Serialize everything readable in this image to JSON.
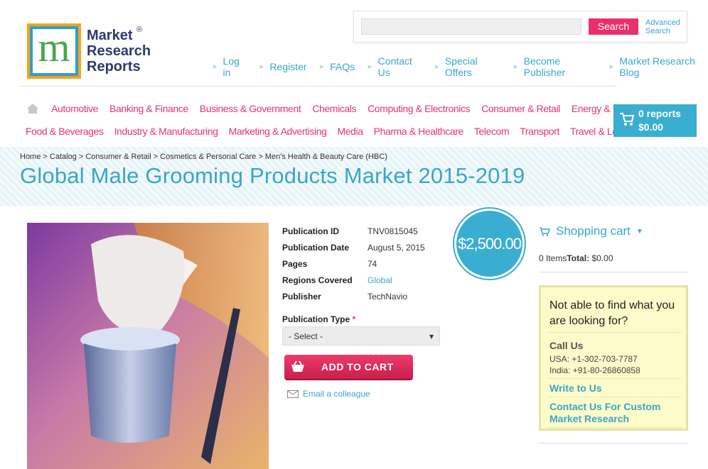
{
  "logo": {
    "line1": "Market",
    "line2": "Research",
    "line3": "Reports",
    "reg": "®",
    "mark": "m"
  },
  "search": {
    "placeholder": "",
    "button": "Search",
    "advanced": "Advanced Search"
  },
  "top_links": [
    "Log in",
    "Register",
    "FAQs",
    "Contact Us",
    "Special Offers",
    "Become Publisher",
    "Market Research Blog"
  ],
  "nav_row1": [
    "Automotive",
    "Banking & Finance",
    "Business & Government",
    "Chemicals",
    "Computing & Electronics",
    "Consumer & Retail",
    "Energy & Utilities"
  ],
  "nav_row2": [
    "Food & Beverages",
    "Industry & Manufacturing",
    "Marketing & Advertising",
    "Media",
    "Pharma & Healthcare",
    "Telecom",
    "Transport",
    "Travel & Leisure"
  ],
  "cart_mini": {
    "reports": "0 reports",
    "amount": "$0.00"
  },
  "breadcrumb": "Home > Catalog > Consumer & Retail > Cosmetics & Personal Care > Men's Health & Beauty Care (HBC)",
  "title": "Global Male Grooming Products Market 2015-2019",
  "details": [
    {
      "k": "Publication ID",
      "v": "TNV0815045"
    },
    {
      "k": "Publication Date",
      "v": "August 5, 2015"
    },
    {
      "k": "Pages",
      "v": "74"
    },
    {
      "k": "Regions Covered",
      "v": "Global"
    },
    {
      "k": "Publisher",
      "v": "TechNavio"
    }
  ],
  "price": "$2,500.00",
  "publication_type": {
    "label": "Publication Type",
    "required": "*",
    "selected": "- Select -"
  },
  "add_to_cart": "ADD TO CART",
  "email_colleague": "Email a colleague",
  "shopping_cart": {
    "title": "Shopping cart",
    "items": "0 Items",
    "total_label": "Total:",
    "total": "$0.00"
  },
  "help": {
    "question": "Not able to find what you are looking for?",
    "call_us": "Call Us",
    "usa": "USA: +1-302-703-7787",
    "india": "India: +91-80-26860858",
    "write": "Write to Us",
    "custom": "Contact Us For Custom Market Research"
  },
  "colors": {
    "accent_blue": "#3aaed0",
    "accent_pink": "#e4356f",
    "logo_orange": "#f4a41c",
    "logo_green": "#47a84b"
  }
}
